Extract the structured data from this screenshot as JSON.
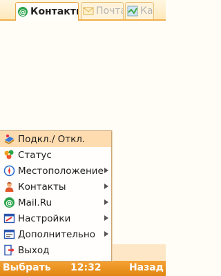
{
  "tabs": [
    {
      "label": "Контакты",
      "icon": "at-icon",
      "active": true
    },
    {
      "label": "Почта",
      "icon": "envelope-icon",
      "active": false
    },
    {
      "label": "Ка",
      "icon": "map-icon",
      "active": false
    }
  ],
  "menu": {
    "items": [
      {
        "label": "Подкл./ Откл.",
        "icon": "connect-icon",
        "selected": true,
        "submenu": false
      },
      {
        "label": "Статус",
        "icon": "status-flower-icon",
        "selected": false,
        "submenu": false
      },
      {
        "label": "Местоположение",
        "icon": "compass-icon",
        "selected": false,
        "submenu": true
      },
      {
        "label": "Контакты",
        "icon": "contacts-person-icon",
        "selected": false,
        "submenu": true
      },
      {
        "label": "Mail.Ru",
        "icon": "mailru-at-icon",
        "selected": false,
        "submenu": true
      },
      {
        "label": "Настройки",
        "icon": "settings-icon",
        "selected": false,
        "submenu": true
      },
      {
        "label": "Дополнительно",
        "icon": "more-window-icon",
        "selected": false,
        "submenu": true
      },
      {
        "label": "Выход",
        "icon": "exit-icon",
        "selected": false,
        "submenu": false
      }
    ]
  },
  "softkeys": {
    "left": "Выбрать",
    "time": "12:32",
    "right": "Назад"
  },
  "colors": {
    "accent": "#f39a2a",
    "selection": "#ffdcb0",
    "mail_green": "#2aa34a"
  }
}
